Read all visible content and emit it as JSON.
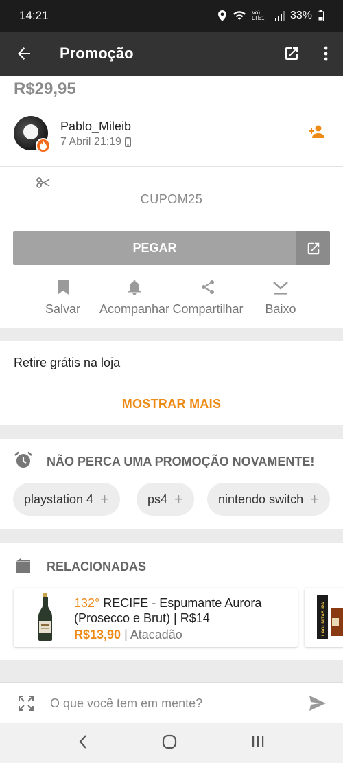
{
  "status_bar": {
    "time": "14:21",
    "battery": "33%",
    "network": "Vo) LTE1"
  },
  "app_bar": {
    "title": "Promoção"
  },
  "deal": {
    "price": "R$29,95",
    "author": "Pablo_Mileib",
    "date": "7 Abril 21:19",
    "coupon": "CUPOM25",
    "get_label": "PEGAR",
    "actions": [
      {
        "label": "Salvar",
        "icon": "bookmark-icon"
      },
      {
        "label": "Acompanhar",
        "icon": "bell-icon"
      },
      {
        "label": "Compartilhar",
        "icon": "share-icon"
      },
      {
        "label": "Baixo",
        "icon": "vote-down-icon"
      }
    ]
  },
  "description": {
    "text": "Retire grátis na loja",
    "more_label": "MOSTRAR MAIS"
  },
  "alerts": {
    "title": "NÃO PERCA UMA PROMOÇÃO NOVAMENTE!",
    "chips": [
      "playstation 4",
      "ps4",
      "nintendo switch"
    ],
    "chip_suffix": "+"
  },
  "related": {
    "title": "RELACIONADAS",
    "items": [
      {
        "temperature": "132°",
        "title": "RECIFE - Espumante Aurora (Prosecco e Brut) | R$14",
        "price": "R$13,90",
        "store": "| Atacadão"
      }
    ],
    "next_item_label": "LAGUNITAS IPA"
  },
  "comment": {
    "placeholder": "O que você tem em mente?"
  },
  "colors": {
    "accent": "#ee8a16",
    "app_bar": "#333333",
    "button_disabled": "#a3a3a3"
  }
}
